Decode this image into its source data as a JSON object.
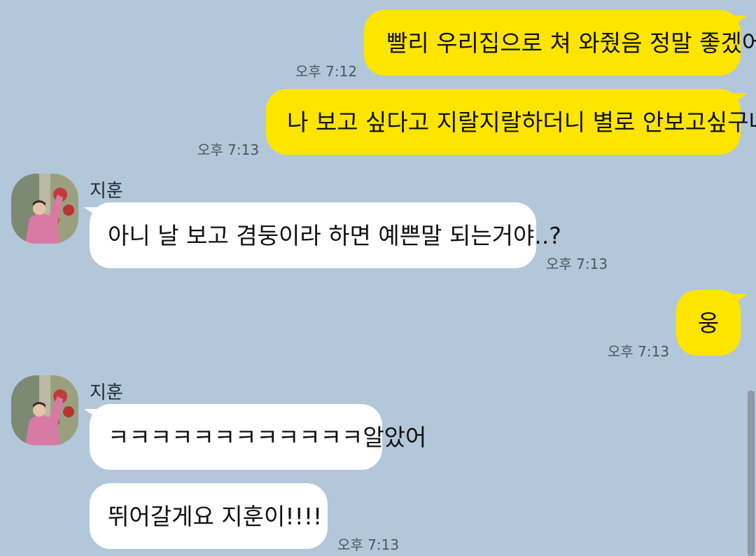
{
  "colors": {
    "background": "#b2c7da",
    "my_bubble": "#fee500",
    "their_bubble": "#ffffff",
    "timestamp": "#4d5561"
  },
  "contact": {
    "name": "지훈",
    "avatar_icon": "profile-photo"
  },
  "messages": [
    {
      "from": "me",
      "text": "빨리 우리집으로 쳐 와줬음 정말 좋겠어",
      "time": "오후 7:12"
    },
    {
      "from": "me",
      "text": "나 보고 싶다고 지랄지랄하더니 별로 안보고싶구나",
      "time": "오후 7:13"
    },
    {
      "from": "them",
      "sender": "지훈",
      "text": "아니 날 보고 겸둥이라 하면 예쁜말 되는거야..?",
      "time": "오후 7:13"
    },
    {
      "from": "me",
      "text": "웅",
      "time": "오후 7:13"
    },
    {
      "from": "them",
      "sender": "지훈",
      "text": "ㅋㅋㅋㅋㅋㅋㅋㅋㅋㅋㅋㅋ알았어"
    },
    {
      "from": "them",
      "text": "뛰어갈게요 지훈이!!!!",
      "time": "오후 7:13"
    }
  ]
}
